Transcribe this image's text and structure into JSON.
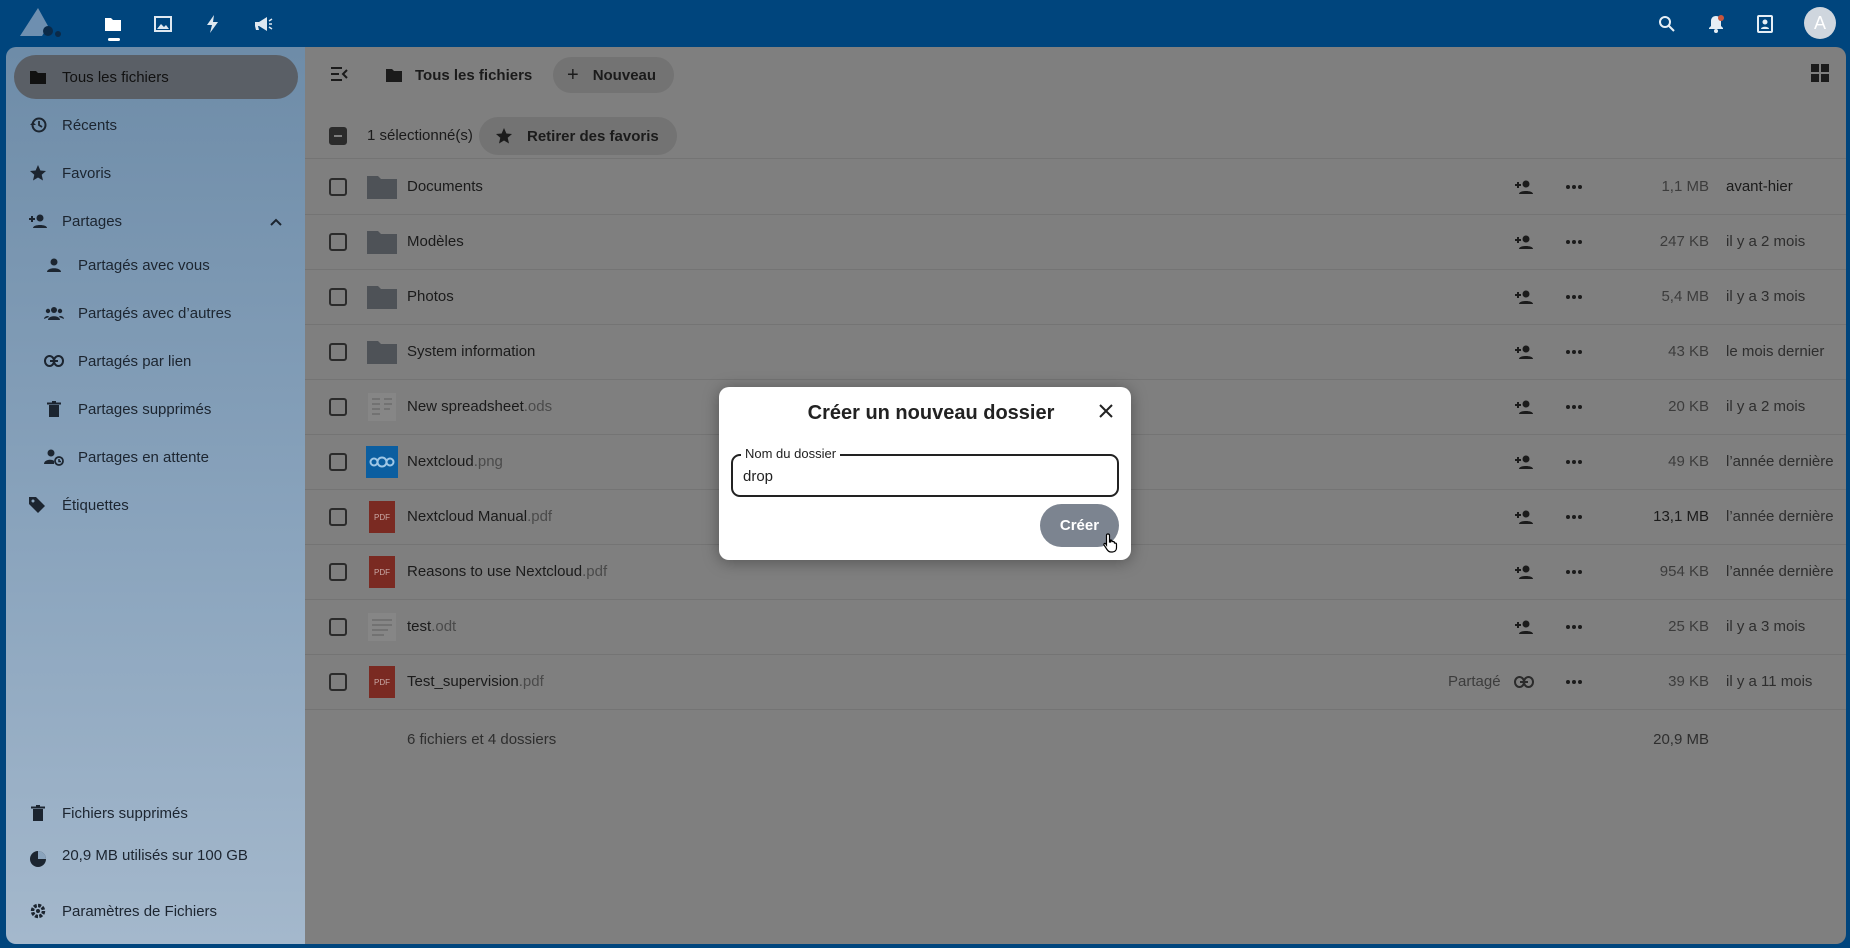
{
  "header": {
    "apps": [
      "files-icon",
      "photos-icon",
      "activity-icon",
      "announcements-icon"
    ],
    "right_icons": [
      "search-icon",
      "notifications-icon",
      "contacts-icon"
    ],
    "avatar_letter": "A"
  },
  "sidebar": {
    "items": [
      {
        "label": "Tous les fichiers",
        "icon": "folder-icon"
      },
      {
        "label": "Récents",
        "icon": "history-icon"
      },
      {
        "label": "Favoris",
        "icon": "star-icon"
      },
      {
        "label": "Partages",
        "icon": "share-icon"
      },
      {
        "label": "Partagés avec vous",
        "icon": "person-icon"
      },
      {
        "label": "Partagés avec d’autres",
        "icon": "group-icon"
      },
      {
        "label": "Partagés par lien",
        "icon": "link-icon"
      },
      {
        "label": "Partages supprimés",
        "icon": "trash-icon"
      },
      {
        "label": "Partages en attente",
        "icon": "pending-icon"
      },
      {
        "label": "Étiquettes",
        "icon": "tag-icon"
      }
    ],
    "footer": {
      "deleted": "Fichiers supprimés",
      "quota": "20,9 MB utilisés sur 100 GB",
      "settings": "Paramètres de Fichiers"
    }
  },
  "toolbar": {
    "breadcrumb": "Tous les fichiers",
    "new_label": "Nouveau",
    "selected_count": "1 sélectionné(s)",
    "unfavorite_label": "Retirer des favoris"
  },
  "files": [
    {
      "name": "Documents",
      "ext": "",
      "type": "folder",
      "size": "1,1 MB",
      "date": "avant-hier"
    },
    {
      "name": "Modèles",
      "ext": "",
      "type": "folder",
      "size": "247 KB",
      "date": "il y a 2 mois"
    },
    {
      "name": "Photos",
      "ext": "",
      "type": "folder",
      "size": "5,4 MB",
      "date": "il y a 3 mois"
    },
    {
      "name": "System information",
      "ext": "",
      "type": "folder",
      "size": "43 KB",
      "date": "le mois dernier"
    },
    {
      "name": "New spreadsheet",
      "ext": ".ods",
      "type": "sheet",
      "size": "20 KB",
      "date": "il y a 2 mois"
    },
    {
      "name": "Nextcloud",
      "ext": ".png",
      "type": "image",
      "size": "49 KB",
      "date": "l’année dernière"
    },
    {
      "name": "Nextcloud Manual",
      "ext": ".pdf",
      "type": "pdf",
      "size": "13,1 MB",
      "date": "l’année dernière"
    },
    {
      "name": "Reasons to use Nextcloud",
      "ext": ".pdf",
      "type": "pdf",
      "size": "954 KB",
      "date": "l’année dernière"
    },
    {
      "name": "test",
      "ext": ".odt",
      "type": "doc",
      "size": "25 KB",
      "date": "il y a 3 mois"
    },
    {
      "name": "Test_supervision",
      "ext": ".pdf",
      "type": "pdf",
      "size": "39 KB",
      "date": "il y a 11 mois",
      "shared_label": "Partagé"
    }
  ],
  "summary": {
    "count": "6 fichiers et 4 dossiers",
    "total": "20,9 MB"
  },
  "dialog": {
    "title": "Créer un nouveau dossier",
    "field_label": "Nom du dossier",
    "field_value": "drop",
    "create_label": "Créer"
  },
  "pdf_badge": "PDF"
}
